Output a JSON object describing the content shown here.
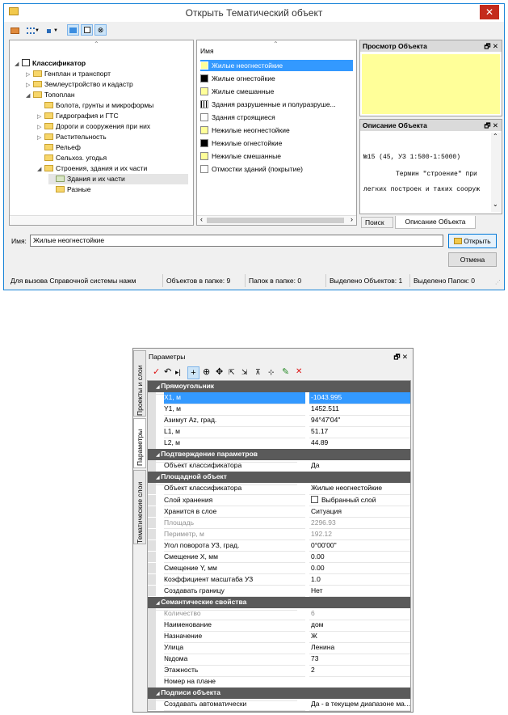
{
  "dialog1": {
    "title": "Открыть Тематический объект",
    "close_glyph": "✕",
    "tree": {
      "root": "Классификатор",
      "items": [
        {
          "label": "Генплан и транспорт",
          "level": 1
        },
        {
          "label": "Землеустройство и кадастр",
          "level": 1
        },
        {
          "label": "Топоплан",
          "level": 1
        },
        {
          "label": "Болота, грунты и микроформы",
          "level": 2
        },
        {
          "label": "Гидрография и ГТС",
          "level": 2
        },
        {
          "label": "Дороги и сооружения при них",
          "level": 2
        },
        {
          "label": "Растительность",
          "level": 2
        },
        {
          "label": "Рельеф",
          "level": 2
        },
        {
          "label": "Сельхоз. угодья",
          "level": 2
        },
        {
          "label": "Строения, здания и их части",
          "level": 2
        },
        {
          "label": "Здания и их части",
          "level": 3
        },
        {
          "label": "Разные",
          "level": 3
        }
      ]
    },
    "list": {
      "header": "Имя",
      "items": [
        {
          "label": "Жилые неогнестойкие",
          "swatch": "#ffff99",
          "selected": true
        },
        {
          "label": "Жилые огнестойкие",
          "swatch": "#000000"
        },
        {
          "label": "Жилые смешанные",
          "swatch": "#ffff99"
        },
        {
          "label": "Здания разрушенные и полуразруше...",
          "swatch": "hatch"
        },
        {
          "label": "Здания строящиеся",
          "swatch": "#ffffff"
        },
        {
          "label": "Нежилые  неогнестойкие",
          "swatch": "#ffff99"
        },
        {
          "label": "Нежилые огнестойкие",
          "swatch": "#000000"
        },
        {
          "label": "Нежилые смешанные",
          "swatch": "#ffff99"
        },
        {
          "label": "Отмостки зданий (покрытие)",
          "swatch": "#ffffff"
        }
      ]
    },
    "preview": {
      "title": "Просмотр Объекта",
      "controls": "🗗 ✕",
      "fill": "#ffff99"
    },
    "description": {
      "title": "Описание Объекта",
      "controls": "🗗 ✕",
      "line1": "№15 (45, УЗ 1:500-1:5000)",
      "line2": "Термин \"строение\" при",
      "line3": "легких построек и таких сооруж"
    },
    "tabs": {
      "search": "Поиск",
      "description": "Описание Объекта"
    },
    "name_label": "Имя:",
    "name_value": "Жилые неогнестойкие",
    "open_button": "Открыть",
    "cancel_button": "Отмена",
    "status": {
      "help": "Для вызова Справочной системы нажм",
      "objects": "Объектов в папке: 9",
      "folders": "Папок в папке: 0",
      "sel_objects": "Выделено Объектов: 1",
      "sel_folders": "Выделено Папок: 0"
    }
  },
  "dialog2": {
    "title": "Параметры",
    "controls": "🗗 ✕",
    "side_tabs": [
      "Проекты и слои",
      "Параметры",
      "Тематические слои"
    ],
    "rows": [
      {
        "type": "sec",
        "label": "Прямоугольник"
      },
      {
        "label": "X1, м",
        "value": "-1043.995",
        "selected": true
      },
      {
        "label": "Y1, м",
        "value": "1452.511"
      },
      {
        "label": "Азимут Az, град.",
        "value": "94°47'04\""
      },
      {
        "label": "L1, м",
        "value": "51.17"
      },
      {
        "label": "L2, м",
        "value": "44.89"
      },
      {
        "type": "sec",
        "label": "Подтверждение параметров"
      },
      {
        "label": "Объект классификатора",
        "value": "Да"
      },
      {
        "type": "sec",
        "label": "Площадной объект"
      },
      {
        "label": "Объект классификатора",
        "value": "Жилые неогнестойкие"
      },
      {
        "label": "Слой хранения",
        "value": "Выбранный слой",
        "checkbox": true
      },
      {
        "label": "Хранится в слое",
        "value": "Ситуация"
      },
      {
        "label": "Площадь",
        "value": "2296.93",
        "disabled": true
      },
      {
        "label": "Периметр, м",
        "value": "192.12",
        "disabled": true
      },
      {
        "label": "Угол поворота УЗ, град.",
        "value": "0°00'00\""
      },
      {
        "label": "Смещение X, мм",
        "value": "0.00"
      },
      {
        "label": "Смещение Y, мм",
        "value": "0.00"
      },
      {
        "label": "Коэффициент масштаба УЗ",
        "value": "1.0"
      },
      {
        "label": "Создавать границу",
        "value": "Нет"
      },
      {
        "type": "sec",
        "label": "Семантические свойства"
      },
      {
        "label": "Количество",
        "value": "6",
        "disabled": true
      },
      {
        "label": "Наименование",
        "value": "дом"
      },
      {
        "label": "Назначение",
        "value": "Ж"
      },
      {
        "label": "Улица",
        "value": "Ленина"
      },
      {
        "label": "№дома",
        "value": "73"
      },
      {
        "label": "Этажность",
        "value": "2"
      },
      {
        "label": "Номер на плане",
        "value": ""
      },
      {
        "type": "sec",
        "label": "Подписи объекта"
      },
      {
        "label": "Создавать автоматически",
        "value": "Да - в текущем диапазоне ма..."
      }
    ]
  }
}
